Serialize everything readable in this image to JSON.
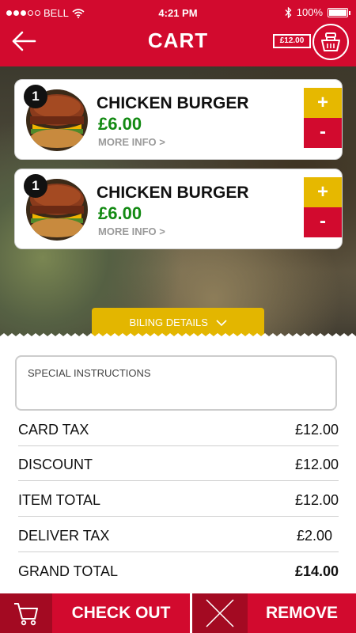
{
  "status_bar": {
    "carrier": "BELL",
    "time": "4:21 PM",
    "battery": "100%",
    "battery_level": 1.0,
    "signal_bars": 3,
    "signal_total": 5
  },
  "header": {
    "title": "CART",
    "cart_total": "£12.00"
  },
  "items": [
    {
      "qty": "1",
      "name": "CHICKEN BURGER",
      "price": "£6.00",
      "more_info": "MORE INFO >",
      "plus": "+",
      "minus": "-"
    },
    {
      "qty": "1",
      "name": "CHICKEN BURGER",
      "price": "£6.00",
      "more_info": "MORE INFO >",
      "plus": "+",
      "minus": "-"
    }
  ],
  "billing": {
    "label": "BILING DETAILS"
  },
  "special_instructions": {
    "placeholder": "SPECIAL INSTRUCTIONS"
  },
  "summary": [
    {
      "label": "CARD TAX",
      "value": "£12.00"
    },
    {
      "label": "DISCOUNT",
      "value": "£12.00"
    },
    {
      "label": "ITEM TOTAL",
      "value": "£12.00"
    },
    {
      "label": "DELIVER TAX",
      "value": "£2.00"
    },
    {
      "label": "GRAND TOTAL",
      "value": "£14.00"
    }
  ],
  "actions": {
    "checkout": "CHECK OUT",
    "remove": "REMOVE"
  },
  "colors": {
    "brand_red": "#d20a2e",
    "dark_red": "#a30a22",
    "accent_yellow": "#e6b800",
    "price_green": "#138a13"
  }
}
